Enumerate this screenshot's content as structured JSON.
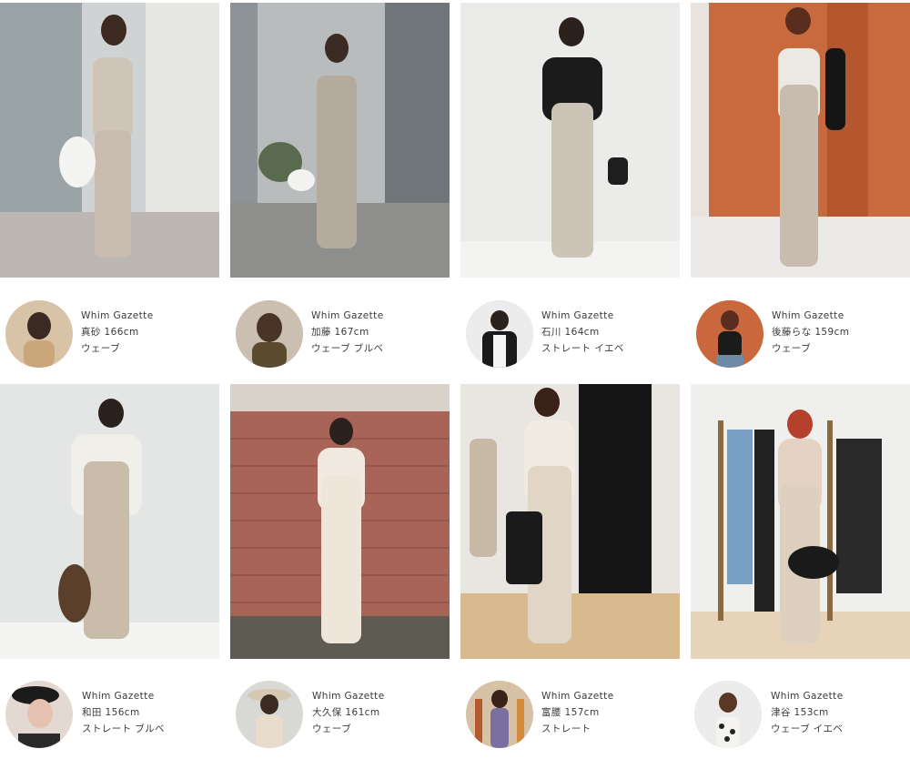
{
  "posts": [
    {
      "brand": "Whim Gazette",
      "name_height": "真砂 166cm",
      "type": "ウェーブ"
    },
    {
      "brand": "Whim Gazette",
      "name_height": "加藤 167cm",
      "type": "ウェーブ ブルベ"
    },
    {
      "brand": "Whim Gazette",
      "name_height": "石川 164cm",
      "type": "ストレート イエベ"
    },
    {
      "brand": "Whim Gazette",
      "name_height": "後藤らな 159cm",
      "type": "ウェーブ"
    },
    {
      "brand": "Whim Gazette",
      "name_height": "和田 156cm",
      "type": "ストレート ブルベ"
    },
    {
      "brand": "Whim Gazette",
      "name_height": "大久保 161cm",
      "type": "ウェーブ"
    },
    {
      "brand": "Whim Gazette",
      "name_height": "富腰 157cm",
      "type": "ストレート"
    },
    {
      "brand": "Whim Gazette",
      "name_height": "津谷 153cm",
      "type": "ウェーブ イエベ"
    }
  ]
}
